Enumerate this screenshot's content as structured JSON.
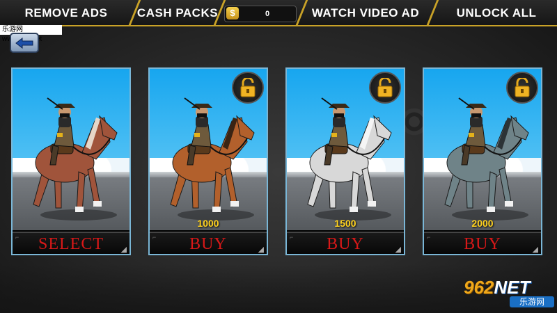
{
  "topbar": {
    "remove_ads": "REMOVE ADS",
    "cash_packs": "CASH PACKS",
    "coin_symbol": "$",
    "cash_value": "0",
    "watch_video_ad": "WATCH VIDEO AD",
    "unlock_all": "UNLOCK ALL"
  },
  "colors": {
    "accent_gold": "#c9a227",
    "label_red": "#d81818",
    "price_yellow": "#ffd21f",
    "card_border": "#7ab6d6"
  },
  "horses": [
    {
      "coat": "#a0543b",
      "mane": "#e7d6c8",
      "locked": false,
      "price": "",
      "action": "SELECT"
    },
    {
      "coat": "#b2602c",
      "mane": "#3a2414",
      "locked": true,
      "price": "1000",
      "action": "BUY"
    },
    {
      "coat": "#d8d8d8",
      "mane": "#f5f5f5",
      "locked": true,
      "price": "1500",
      "action": "BUY"
    },
    {
      "coat": "#6f8388",
      "mane": "#2c3336",
      "locked": true,
      "price": "2000",
      "action": "BUY"
    }
  ],
  "watermark": {
    "url": "乐游网www.962.net",
    "logo_number": "962",
    "logo_net": "NET",
    "logo_cn": "乐游网"
  },
  "icons": {
    "back": "arrow-left-icon",
    "lock": "unlocked-padlock-icon",
    "coin": "dollar-coin-icon"
  }
}
